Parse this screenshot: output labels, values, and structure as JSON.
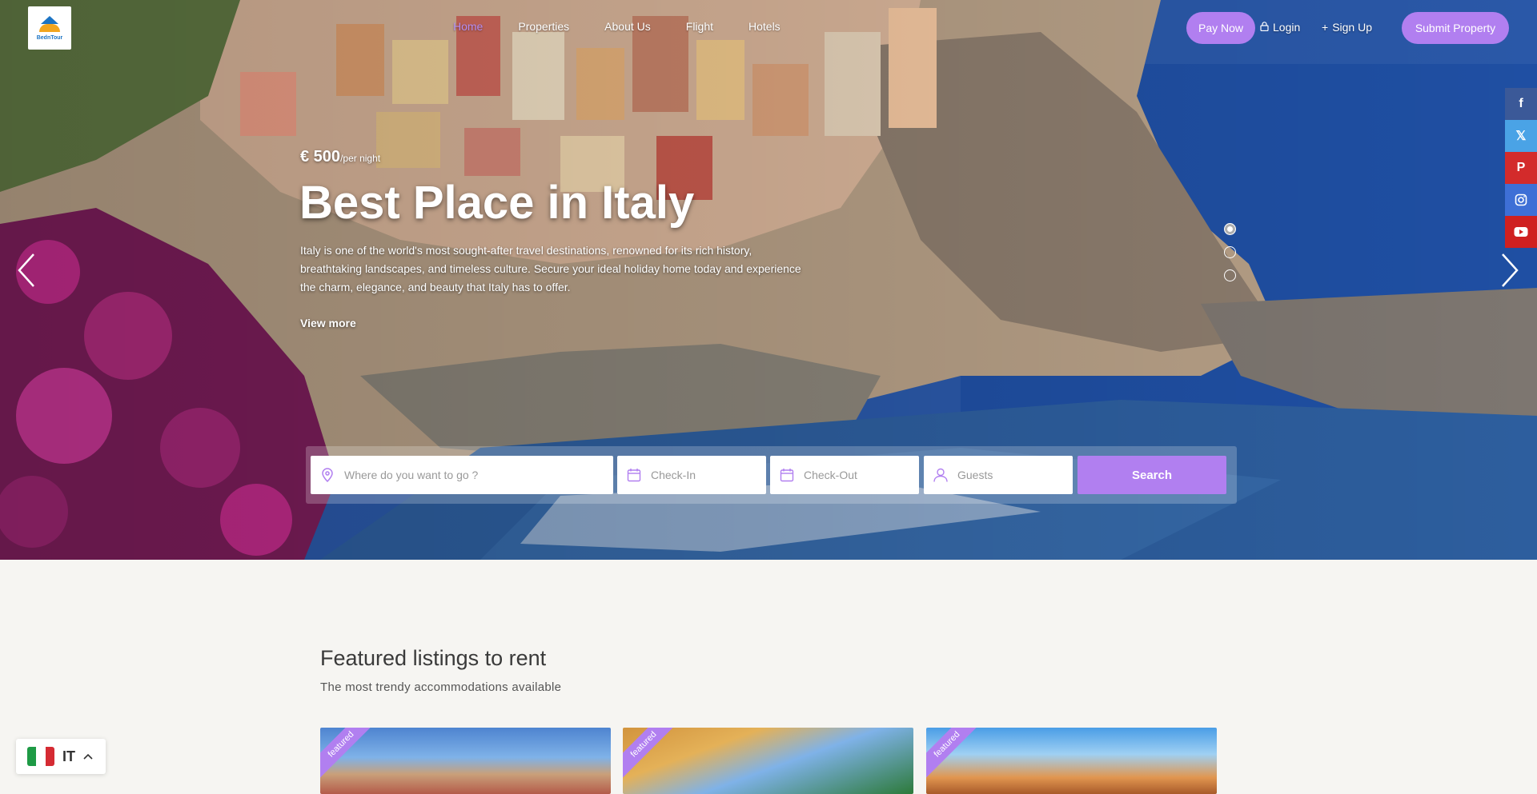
{
  "header": {
    "logo_text": "BednTour",
    "nav": [
      "Home",
      "Properties",
      "About Us",
      "Flight",
      "Hotels"
    ],
    "pay_now": "Pay Now",
    "login": "Login",
    "signup": "Sign Up",
    "submit_property": "Submit Property",
    "accent_color": "#b17ff0"
  },
  "hero": {
    "price": "€ 500",
    "price_unit": "/per night",
    "title": "Best Place in Italy",
    "description": "Italy is one of the world's most sought-after travel destinations, renowned for its rich history, breathtaking landscapes, and timeless culture. Secure your ideal holiday home today and experience the charm, elegance, and beauty that Italy has to offer.",
    "view_more": "View more",
    "slide_count": 3,
    "active_slide": 1
  },
  "search": {
    "where_placeholder": "Where do you want to go ?",
    "checkin_placeholder": "Check-In",
    "checkout_placeholder": "Check-Out",
    "guests_placeholder": "Guests",
    "button": "Search"
  },
  "social": [
    "facebook-icon",
    "x-icon",
    "pinterest-icon",
    "instagram-icon",
    "youtube-icon"
  ],
  "featured": {
    "title": "Featured listings to rent",
    "subtitle": "The most trendy accommodations available",
    "badge": "featured"
  },
  "language": {
    "code": "IT"
  }
}
